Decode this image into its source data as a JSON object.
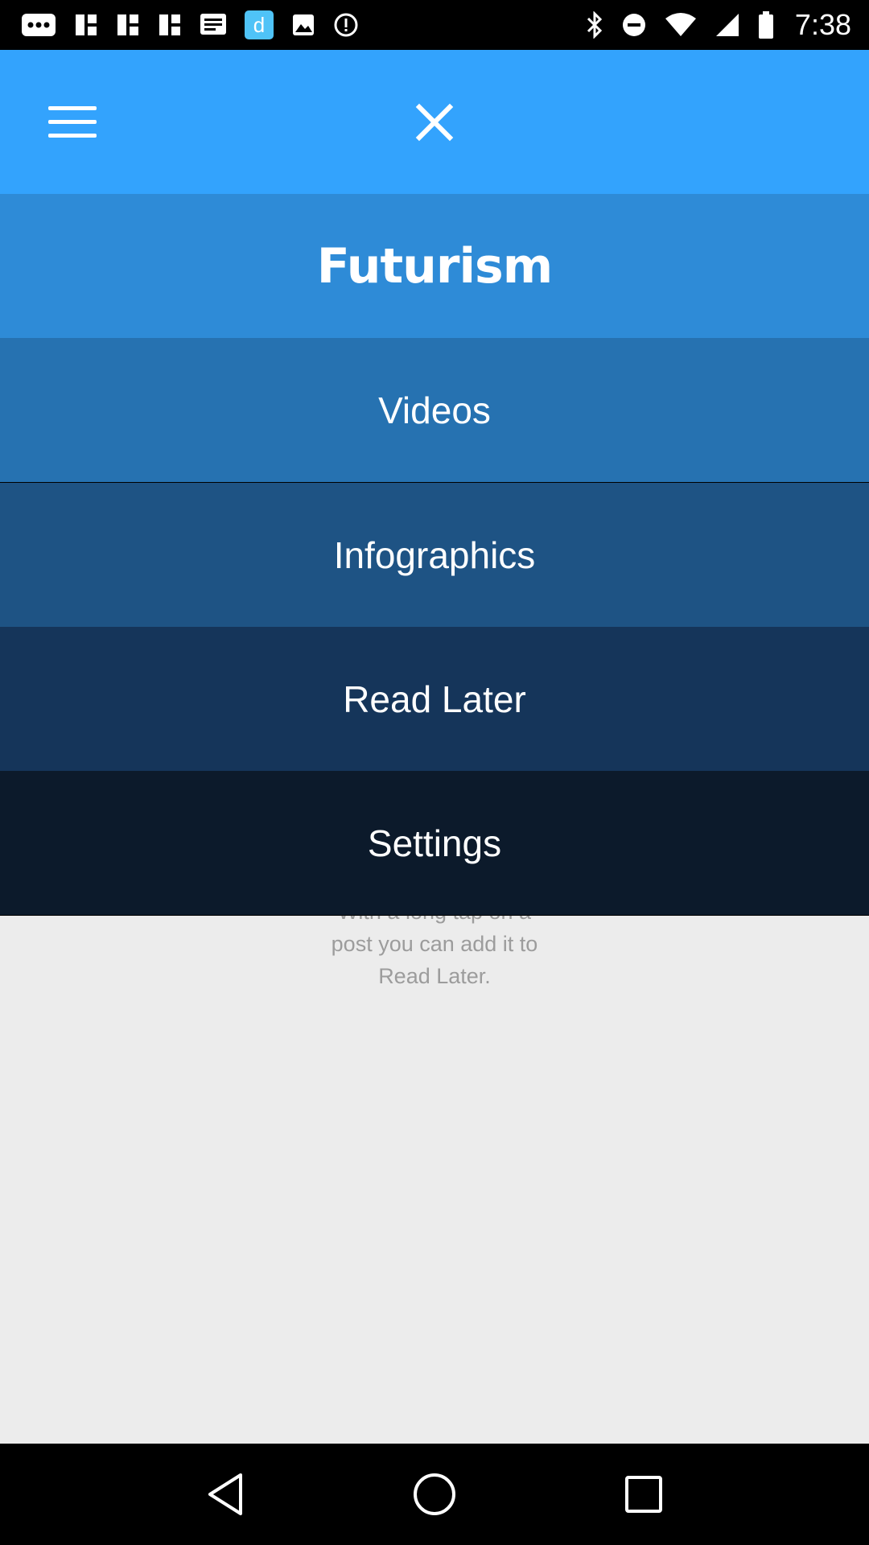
{
  "status_bar": {
    "time": "7:38",
    "left_icons": [
      "more-dots-icon",
      "grid-icon",
      "grid-icon",
      "grid-icon",
      "message-icon",
      "app-d-icon",
      "image-icon",
      "alert-icon"
    ],
    "right_icons": [
      "bluetooth-icon",
      "do-not-disturb-icon",
      "wifi-icon",
      "signal-icon",
      "battery-icon"
    ]
  },
  "toolbar": {
    "menu_icon": "menu-icon",
    "close_icon": "close-icon",
    "color": "#33a3fd"
  },
  "menu": {
    "logo": "Futurism",
    "items": [
      {
        "label": "Videos",
        "color": "#2672b1"
      },
      {
        "label": "Infographics",
        "color": "#1e5384"
      },
      {
        "label": "Read Later",
        "color": "#15355a"
      },
      {
        "label": "Settings",
        "color": "#0c1a2b"
      }
    ]
  },
  "content": {
    "hint_line1": "With a long tap on a",
    "hint_line2": "post you can add it to",
    "hint_line3": "Read Later."
  },
  "nav_bar": {
    "icons": [
      "back-icon",
      "home-icon",
      "recents-icon"
    ]
  }
}
